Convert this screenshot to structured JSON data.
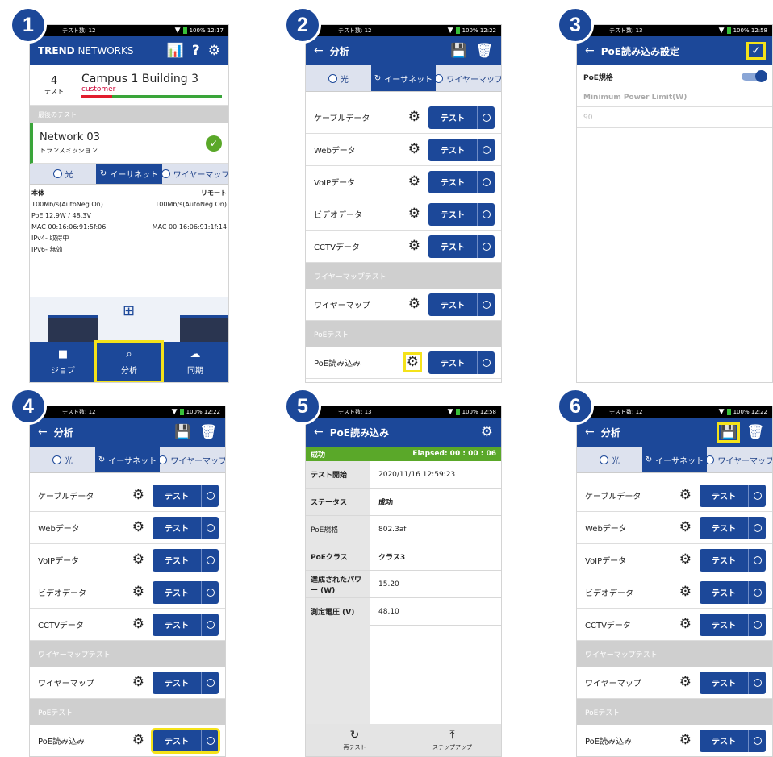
{
  "steps": [
    "1",
    "2",
    "3",
    "4",
    "5",
    "6"
  ],
  "status": {
    "p1_tests": "テスト数: 12",
    "p1_time": "100% 12:17",
    "p2_tests": "テスト数: 12",
    "p2_time": "100% 12:22",
    "p3_tests": "テスト数: 13",
    "p3_time": "100% 12:58",
    "p4_tests": "テスト数: 12",
    "p4_time": "100% 12:22",
    "p5_tests": "テスト数: 13",
    "p5_time": "100% 12:58",
    "p6_tests": "テスト数: 12",
    "p6_time": "100% 12:22"
  },
  "p1": {
    "brand": "TREND",
    "brand2": " NETWORKS",
    "count": "4",
    "count_label": "テスト",
    "building": "Campus 1 Building 3",
    "customer": "customer",
    "last_test": "最後のテスト",
    "network": "Network 03",
    "network_sub": "トランスミッション",
    "tabs": [
      "光",
      "イーサネット",
      "ワイヤーマップ"
    ],
    "main_label": "本体",
    "remote_label": "リモート",
    "left": [
      "100Mb/s(AutoNeg On)",
      "PoE 12.9W / 48.3V",
      "MAC 00:16:06:91:5f:06",
      "IPv4- 取得中",
      "IPv6- 無効"
    ],
    "right": [
      "100Mb/s(AutoNeg On)",
      "",
      "MAC 00:16:06:91:1f:14"
    ],
    "nav": [
      "ジョブ",
      "分析",
      "同期"
    ]
  },
  "analysis": {
    "title": "分析",
    "tabs": [
      "光",
      "イーサネット",
      "ワイヤーマップ"
    ],
    "rows": [
      "ケーブルデータ",
      "Webデータ",
      "VoIPデータ",
      "ビデオデータ",
      "CCTVデータ"
    ],
    "wiremap_section": "ワイヤーマップテスト",
    "wiremap": "ワイヤーマップ",
    "poe_section": "PoEテスト",
    "poe": "PoE読み込み",
    "test": "テスト"
  },
  "p3": {
    "title": "PoE読み込み設定",
    "poe_std": "PoE規格",
    "min_power": "Minimum Power Limit(W)",
    "min_val": "90"
  },
  "p5": {
    "title": "PoE読み込み",
    "success": "成功",
    "elapsed": "Elapsed: 00 : 00 : 06",
    "rows": [
      [
        "テスト開始",
        "2020/11/16 12:59:23"
      ],
      [
        "ステータス",
        "成功"
      ],
      [
        "PoE規格",
        "802.3af"
      ],
      [
        "PoEクラス",
        "クラス3"
      ],
      [
        "達成されたパワー (W)",
        "15.20"
      ],
      [
        "測定電圧 (V)",
        "48.10"
      ]
    ],
    "retest": "再テスト",
    "stepup": "ステップアップ"
  },
  "colors": {
    "primary": "#1c4899",
    "highlight": "#f4e21a",
    "success": "#5aa829"
  }
}
